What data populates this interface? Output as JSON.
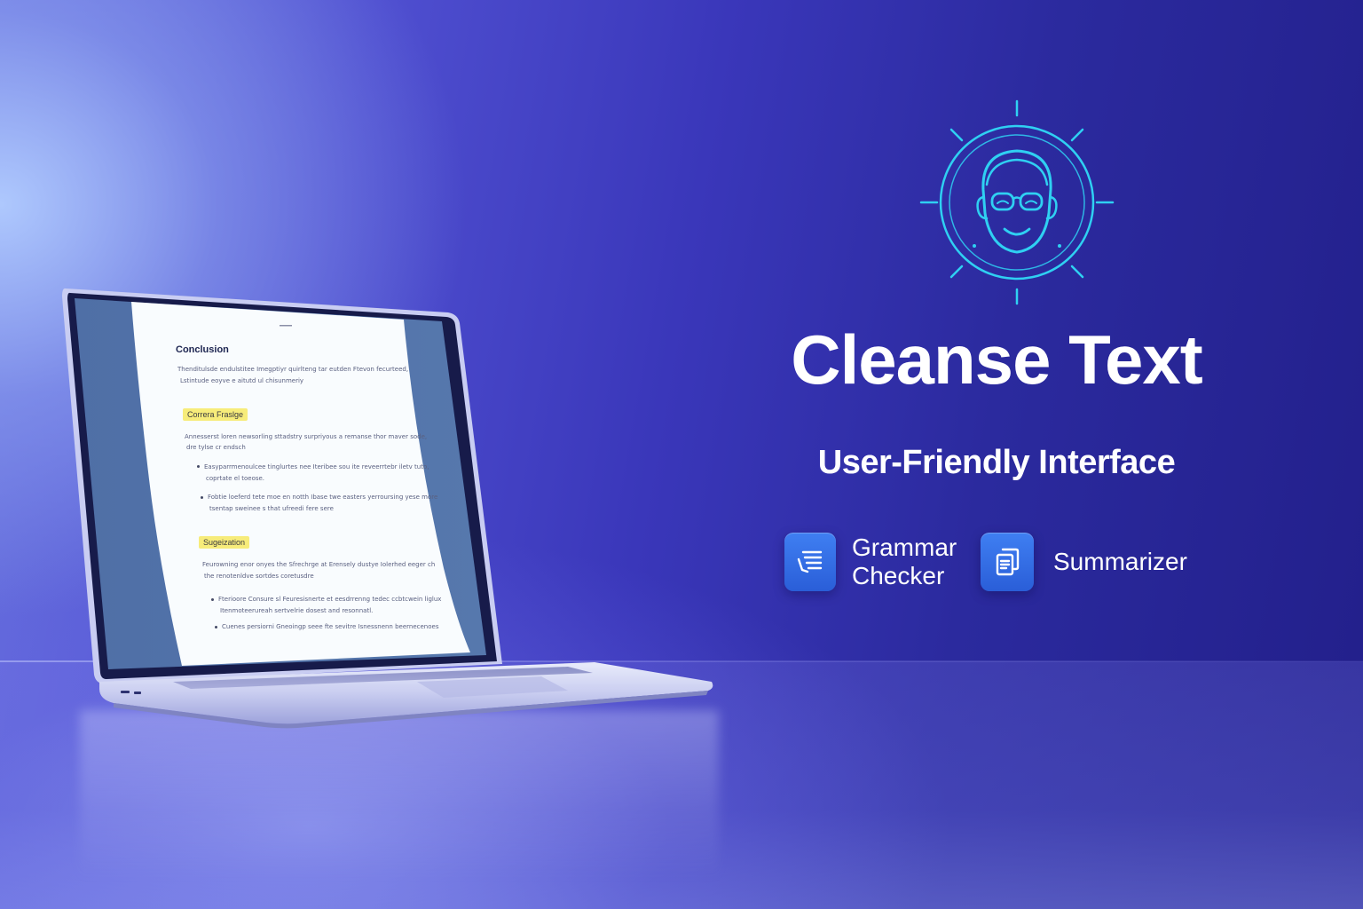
{
  "hero": {
    "title": "Cleanse Text",
    "subtitle": "User-Friendly Interface",
    "logo_icon": "person-with-glasses-icon"
  },
  "features": [
    {
      "name": "Grammar Checker",
      "lines": [
        "Grammar",
        "Checker"
      ],
      "icon": "text-list-icon"
    },
    {
      "name": "Summarizer",
      "lines": [
        "Summarizer"
      ],
      "icon": "documents-copy-icon"
    }
  ],
  "document": {
    "heading": "Conclusion",
    "intro_lines": [
      "Thenditulsde endulstitee Imegptiyr quirlteng tar eutden Ftevon fecurteed,",
      "Lstintude eoyve e aitutd ul chisunmeriy"
    ],
    "section1_tag": "Correra Fraslge",
    "section1_lines": [
      "Annesserst loren newsorling sttadstry surpriyous a remanse thor maver sode,",
      "dre tylse cr endsch"
    ],
    "section1_bullets": [
      [
        "Easyparrmenoulcee tinglurtes nee Iteribee sou ite reveerrtebr iletv tuto,",
        "coprtate el toeose."
      ],
      [
        "Fobtie loeferd tete moe en notth Ibase twe easters yerroursing yese more",
        "tsentap sweinee s that ufreedi fere sere"
      ]
    ],
    "section2_tag": "Sugeization",
    "section2_lines": [
      "Feurowning enor onyes the Sfrechrge at Erensely dustye Iolerhed eeger ch",
      "the renotenldve sortdes coretusdre"
    ],
    "section2_bullets": [
      [
        "Fterioore Consure sl Feuresisnerte et eesdrrenng tedec ccbtcwein liglux",
        "Itenmoteerureah sertvelrie dosest and resonnatl."
      ],
      [
        "Cuenes persiorni Gneoingp seee fte sevitre Isnessnenn beernecenoes"
      ]
    ]
  },
  "colors": {
    "accent_cyan": "#29d3f0",
    "feature_icon_blue": "#3a74ee",
    "highlight_yellow": "#f7ec7a",
    "background_deep": "#221f8a"
  }
}
